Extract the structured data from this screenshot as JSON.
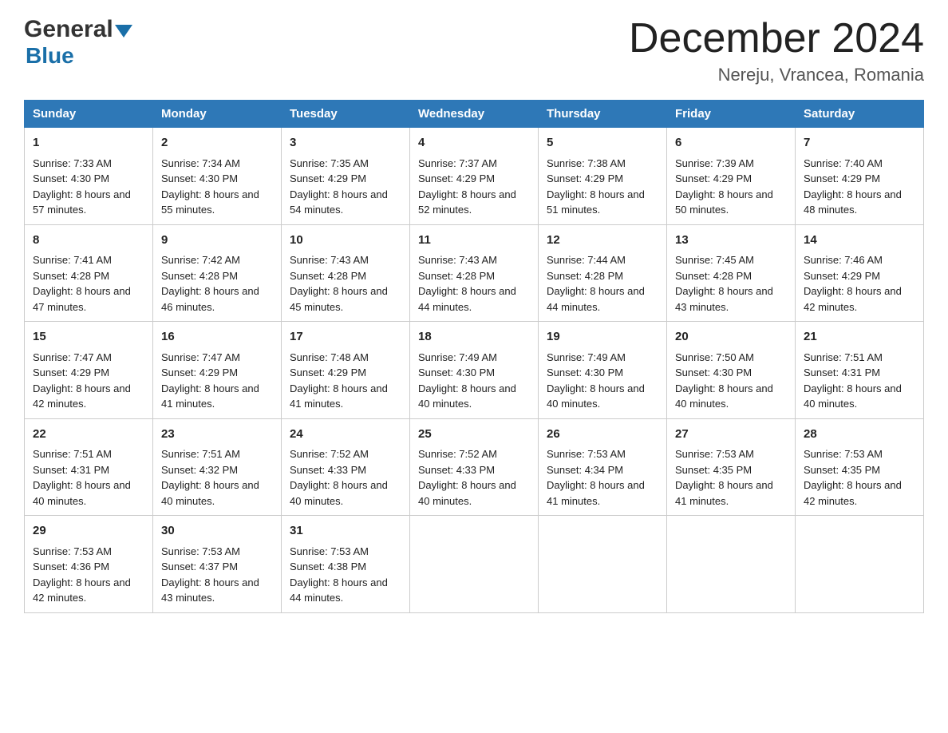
{
  "header": {
    "logo_line1": "General",
    "logo_line2": "Blue",
    "title": "December 2024",
    "subtitle": "Nereju, Vrancea, Romania"
  },
  "calendar": {
    "days_of_week": [
      "Sunday",
      "Monday",
      "Tuesday",
      "Wednesday",
      "Thursday",
      "Friday",
      "Saturday"
    ],
    "weeks": [
      [
        {
          "day": "1",
          "sunrise": "7:33 AM",
          "sunset": "4:30 PM",
          "daylight": "8 hours and 57 minutes."
        },
        {
          "day": "2",
          "sunrise": "7:34 AM",
          "sunset": "4:30 PM",
          "daylight": "8 hours and 55 minutes."
        },
        {
          "day": "3",
          "sunrise": "7:35 AM",
          "sunset": "4:29 PM",
          "daylight": "8 hours and 54 minutes."
        },
        {
          "day": "4",
          "sunrise": "7:37 AM",
          "sunset": "4:29 PM",
          "daylight": "8 hours and 52 minutes."
        },
        {
          "day": "5",
          "sunrise": "7:38 AM",
          "sunset": "4:29 PM",
          "daylight": "8 hours and 51 minutes."
        },
        {
          "day": "6",
          "sunrise": "7:39 AM",
          "sunset": "4:29 PM",
          "daylight": "8 hours and 50 minutes."
        },
        {
          "day": "7",
          "sunrise": "7:40 AM",
          "sunset": "4:29 PM",
          "daylight": "8 hours and 48 minutes."
        }
      ],
      [
        {
          "day": "8",
          "sunrise": "7:41 AM",
          "sunset": "4:28 PM",
          "daylight": "8 hours and 47 minutes."
        },
        {
          "day": "9",
          "sunrise": "7:42 AM",
          "sunset": "4:28 PM",
          "daylight": "8 hours and 46 minutes."
        },
        {
          "day": "10",
          "sunrise": "7:43 AM",
          "sunset": "4:28 PM",
          "daylight": "8 hours and 45 minutes."
        },
        {
          "day": "11",
          "sunrise": "7:43 AM",
          "sunset": "4:28 PM",
          "daylight": "8 hours and 44 minutes."
        },
        {
          "day": "12",
          "sunrise": "7:44 AM",
          "sunset": "4:28 PM",
          "daylight": "8 hours and 44 minutes."
        },
        {
          "day": "13",
          "sunrise": "7:45 AM",
          "sunset": "4:28 PM",
          "daylight": "8 hours and 43 minutes."
        },
        {
          "day": "14",
          "sunrise": "7:46 AM",
          "sunset": "4:29 PM",
          "daylight": "8 hours and 42 minutes."
        }
      ],
      [
        {
          "day": "15",
          "sunrise": "7:47 AM",
          "sunset": "4:29 PM",
          "daylight": "8 hours and 42 minutes."
        },
        {
          "day": "16",
          "sunrise": "7:47 AM",
          "sunset": "4:29 PM",
          "daylight": "8 hours and 41 minutes."
        },
        {
          "day": "17",
          "sunrise": "7:48 AM",
          "sunset": "4:29 PM",
          "daylight": "8 hours and 41 minutes."
        },
        {
          "day": "18",
          "sunrise": "7:49 AM",
          "sunset": "4:30 PM",
          "daylight": "8 hours and 40 minutes."
        },
        {
          "day": "19",
          "sunrise": "7:49 AM",
          "sunset": "4:30 PM",
          "daylight": "8 hours and 40 minutes."
        },
        {
          "day": "20",
          "sunrise": "7:50 AM",
          "sunset": "4:30 PM",
          "daylight": "8 hours and 40 minutes."
        },
        {
          "day": "21",
          "sunrise": "7:51 AM",
          "sunset": "4:31 PM",
          "daylight": "8 hours and 40 minutes."
        }
      ],
      [
        {
          "day": "22",
          "sunrise": "7:51 AM",
          "sunset": "4:31 PM",
          "daylight": "8 hours and 40 minutes."
        },
        {
          "day": "23",
          "sunrise": "7:51 AM",
          "sunset": "4:32 PM",
          "daylight": "8 hours and 40 minutes."
        },
        {
          "day": "24",
          "sunrise": "7:52 AM",
          "sunset": "4:33 PM",
          "daylight": "8 hours and 40 minutes."
        },
        {
          "day": "25",
          "sunrise": "7:52 AM",
          "sunset": "4:33 PM",
          "daylight": "8 hours and 40 minutes."
        },
        {
          "day": "26",
          "sunrise": "7:53 AM",
          "sunset": "4:34 PM",
          "daylight": "8 hours and 41 minutes."
        },
        {
          "day": "27",
          "sunrise": "7:53 AM",
          "sunset": "4:35 PM",
          "daylight": "8 hours and 41 minutes."
        },
        {
          "day": "28",
          "sunrise": "7:53 AM",
          "sunset": "4:35 PM",
          "daylight": "8 hours and 42 minutes."
        }
      ],
      [
        {
          "day": "29",
          "sunrise": "7:53 AM",
          "sunset": "4:36 PM",
          "daylight": "8 hours and 42 minutes."
        },
        {
          "day": "30",
          "sunrise": "7:53 AM",
          "sunset": "4:37 PM",
          "daylight": "8 hours and 43 minutes."
        },
        {
          "day": "31",
          "sunrise": "7:53 AM",
          "sunset": "4:38 PM",
          "daylight": "8 hours and 44 minutes."
        },
        null,
        null,
        null,
        null
      ]
    ],
    "labels": {
      "sunrise": "Sunrise:",
      "sunset": "Sunset:",
      "daylight": "Daylight:"
    }
  }
}
